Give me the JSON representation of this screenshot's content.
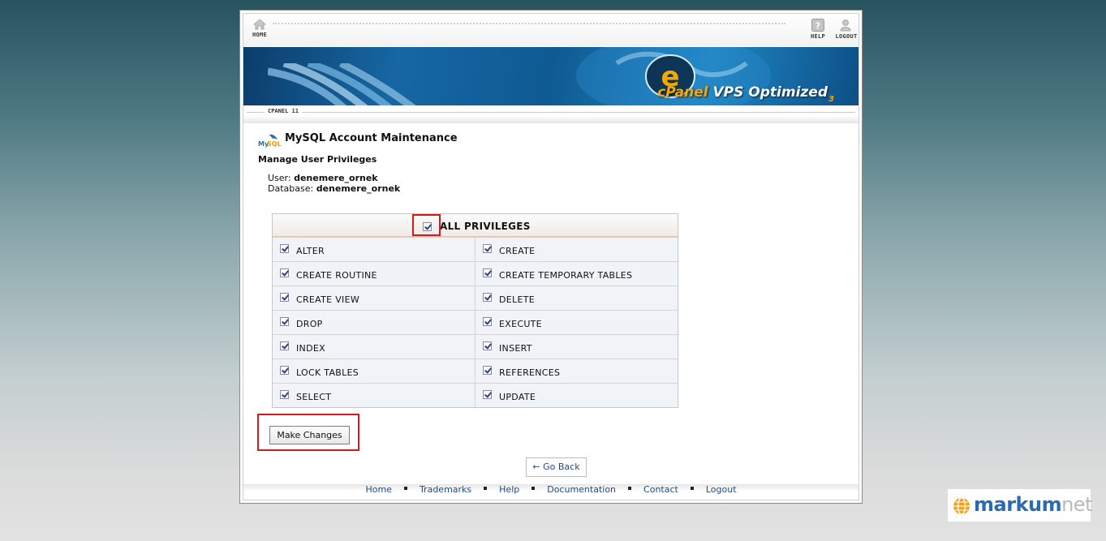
{
  "topnav": {
    "home_label": "HOME",
    "help_label": "HELP",
    "logout_label": "LOGOUT"
  },
  "banner": {
    "brand": "cPanel",
    "product": "VPS Optimized",
    "edition": "3"
  },
  "version_label": "CPANEL 11",
  "header": {
    "title": "MySQL Account Maintenance",
    "subtitle": "Manage User Privileges"
  },
  "account": {
    "user_label": "User:",
    "user_value": "denemere_ornek",
    "database_label": "Database:",
    "database_value": "denemere_ornek"
  },
  "privileges": {
    "all_label": "ALL PRIVILEGES",
    "all_checked": true,
    "rows": [
      [
        {
          "label": "ALTER",
          "checked": true
        },
        {
          "label": "CREATE",
          "checked": true
        }
      ],
      [
        {
          "label": "CREATE ROUTINE",
          "checked": true
        },
        {
          "label": "CREATE TEMPORARY TABLES",
          "checked": true
        }
      ],
      [
        {
          "label": "CREATE VIEW",
          "checked": true
        },
        {
          "label": "DELETE",
          "checked": true
        }
      ],
      [
        {
          "label": "DROP",
          "checked": true
        },
        {
          "label": "EXECUTE",
          "checked": true
        }
      ],
      [
        {
          "label": "INDEX",
          "checked": true
        },
        {
          "label": "INSERT",
          "checked": true
        }
      ],
      [
        {
          "label": "LOCK TABLES",
          "checked": true
        },
        {
          "label": "REFERENCES",
          "checked": true
        }
      ],
      [
        {
          "label": "SELECT",
          "checked": true
        },
        {
          "label": "UPDATE",
          "checked": true
        }
      ]
    ]
  },
  "actions": {
    "make_changes_label": "Make Changes",
    "go_back_label": "← Go Back"
  },
  "footer": {
    "links": [
      "Home",
      "Trademarks",
      "Help",
      "Documentation",
      "Contact",
      "Logout"
    ]
  },
  "watermark": {
    "brand": "markum",
    "suffix": "net"
  },
  "colors": {
    "highlight_red": "#d41a1a",
    "link_blue": "#1b4c87",
    "brand_orange": "#f6a800"
  }
}
